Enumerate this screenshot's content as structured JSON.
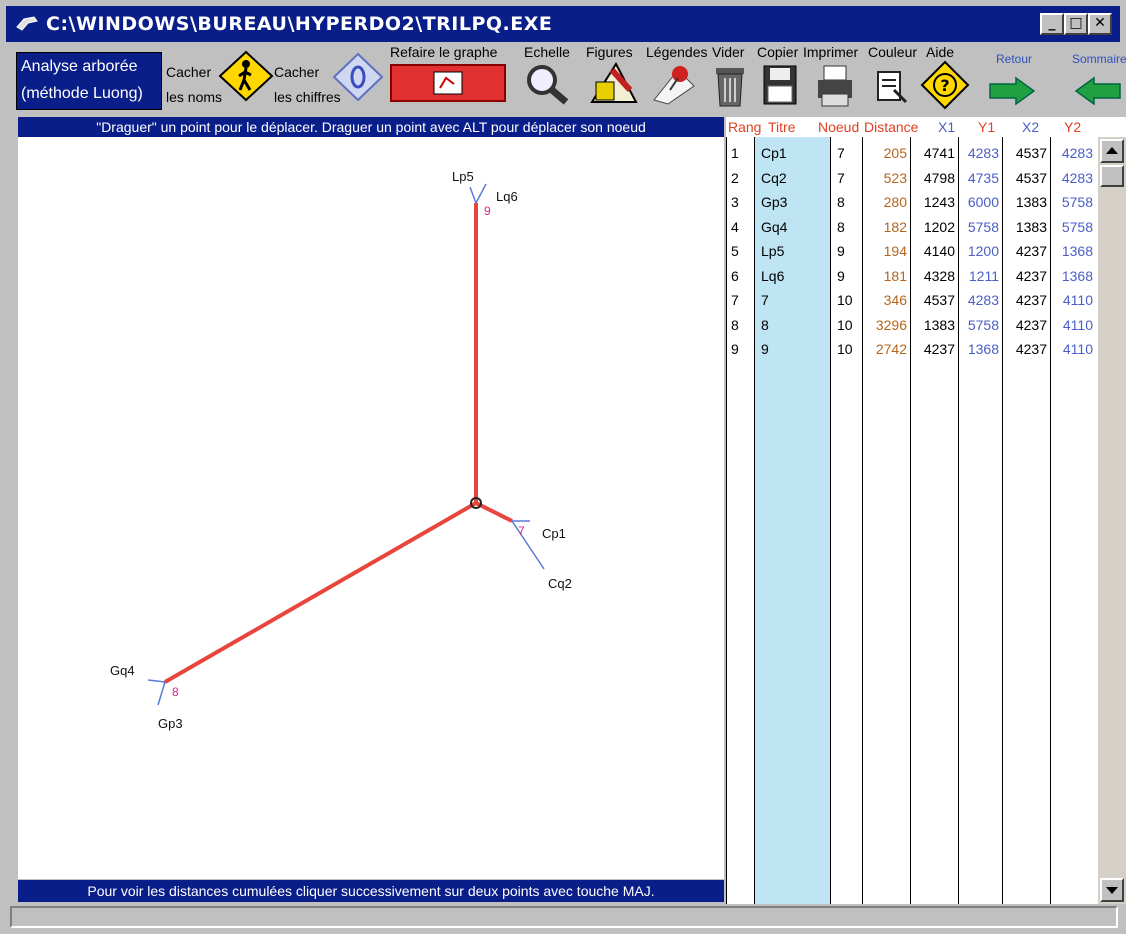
{
  "window": {
    "title": "C:\\WINDOWS\\BUREAU\\HYPERDO2\\TRILPQ.EXE"
  },
  "toolbar": {
    "analyse_line1": "Analyse arborée",
    "analyse_line2": "(méthode Luong)",
    "cacher_noms_1": "Cacher",
    "cacher_noms_2": "les noms",
    "cacher_chiffres_1": "Cacher",
    "cacher_chiffres_2": "les chiffres",
    "refaire": "Refaire le graphe",
    "echelle": "Echelle",
    "figures": "Figures",
    "legendes": "Légendes",
    "vider": "Vider",
    "copier": "Copier",
    "imprimer": "Imprimer",
    "couleur": "Couleur",
    "aide": "Aide",
    "retour": "Retour",
    "sommaire": "Sommaire"
  },
  "message_top": "\"Draguer\" un point pour le déplacer. Draguer un point avec ALT pour déplacer son noeud",
  "message_bottom": "Pour voir les distances cumulées cliquer successivement sur deux points avec touche MAJ.",
  "colors": {
    "titlebar": "#0a1e8a",
    "edge": "#e8463c",
    "leaf": "#5a7ad8",
    "node_label": "#e0208a",
    "distance": "#b5651d",
    "y_col": "#4a5ec8",
    "titre_bg": "#bfe4f4"
  },
  "table": {
    "headers": [
      "Rang",
      "Titre",
      "Noeud",
      "Distance",
      "X1",
      "Y1",
      "X2",
      "Y2"
    ],
    "rows": [
      [
        "1",
        "Cp1",
        "7",
        "205",
        "4741",
        "4283",
        "4537",
        "4283"
      ],
      [
        "2",
        "Cq2",
        "7",
        "523",
        "4798",
        "4735",
        "4537",
        "4283"
      ],
      [
        "3",
        "Gp3",
        "8",
        "280",
        "1243",
        "6000",
        "1383",
        "5758"
      ],
      [
        "4",
        "Gq4",
        "8",
        "182",
        "1202",
        "5758",
        "1383",
        "5758"
      ],
      [
        "5",
        "Lp5",
        "9",
        "194",
        "4140",
        "1200",
        "4237",
        "1368"
      ],
      [
        "6",
        "Lq6",
        "9",
        "181",
        "4328",
        "1211",
        "4237",
        "1368"
      ],
      [
        "7",
        "7",
        "10",
        "346",
        "4537",
        "4283",
        "4237",
        "4110"
      ],
      [
        "8",
        "8",
        "10",
        "3296",
        "1383",
        "5758",
        "4237",
        "4110"
      ],
      [
        "9",
        "9",
        "10",
        "2742",
        "4237",
        "1368",
        "4237",
        "4110"
      ]
    ]
  },
  "graph": {
    "leaf_labels": {
      "lp5": "Lp5",
      "lq6": "Lq6",
      "cp1": "Cp1",
      "cq2": "Cq2",
      "gq4": "Gq4",
      "gp3": "Gp3"
    },
    "node_labels": {
      "n9": "9",
      "n7": "7",
      "n8": "8"
    }
  }
}
